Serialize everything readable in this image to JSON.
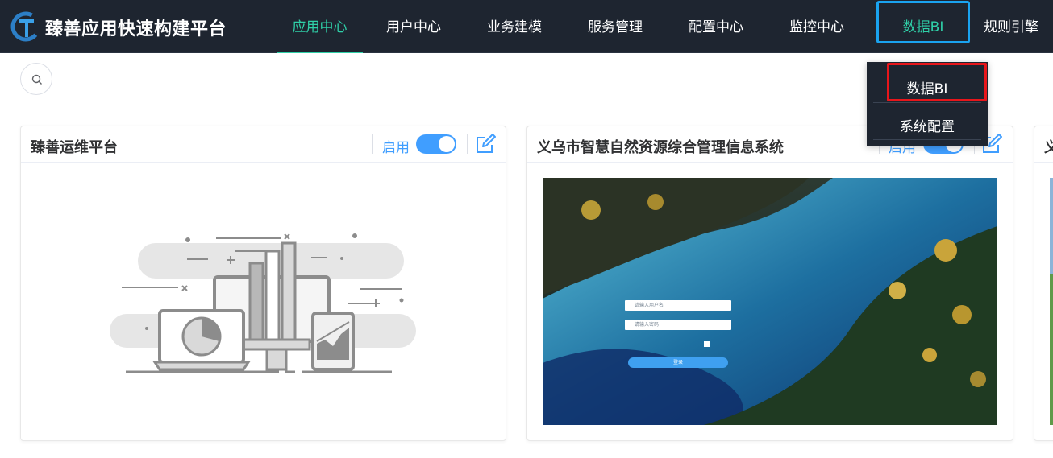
{
  "header": {
    "brand": "臻善应用快速构建平台",
    "logo_icon": "platform-logo-icon",
    "nav": [
      {
        "label": "应用中心",
        "active": true
      },
      {
        "label": "用户中心",
        "active": false
      },
      {
        "label": "业务建模",
        "active": false
      },
      {
        "label": "服务管理",
        "active": false
      },
      {
        "label": "配置中心",
        "active": false
      },
      {
        "label": "监控中心",
        "active": false
      },
      {
        "label": "数据BI",
        "active": false
      },
      {
        "label": "规则引擎",
        "active": false
      }
    ],
    "colors": {
      "background": "#1e2530",
      "accent": "#2fd0a8",
      "highlight_blue": "#1aa3f0",
      "highlight_red": "#e8161b"
    }
  },
  "dropdown": {
    "items": [
      {
        "label": "数据BI"
      },
      {
        "label": "系统配置"
      }
    ]
  },
  "search": {
    "icon": "search-icon"
  },
  "cards": [
    {
      "title": "臻善运维平台",
      "status_label": "启用",
      "enabled": true,
      "preview": "illustration-placeholder"
    },
    {
      "title": "义乌市智慧自然资源综合管理信息系统",
      "status_label": "启用",
      "enabled": true,
      "preview": "landscape-login-screenshot",
      "login": {
        "username_placeholder": "请输入用户名",
        "password_placeholder": "请输入密码",
        "login_label": "登录"
      }
    },
    {
      "title": "义",
      "status_label": "",
      "enabled": true,
      "preview": "landscape-screenshot"
    }
  ],
  "colors": {
    "switch_on": "#409eff",
    "status_text": "#409eff"
  }
}
